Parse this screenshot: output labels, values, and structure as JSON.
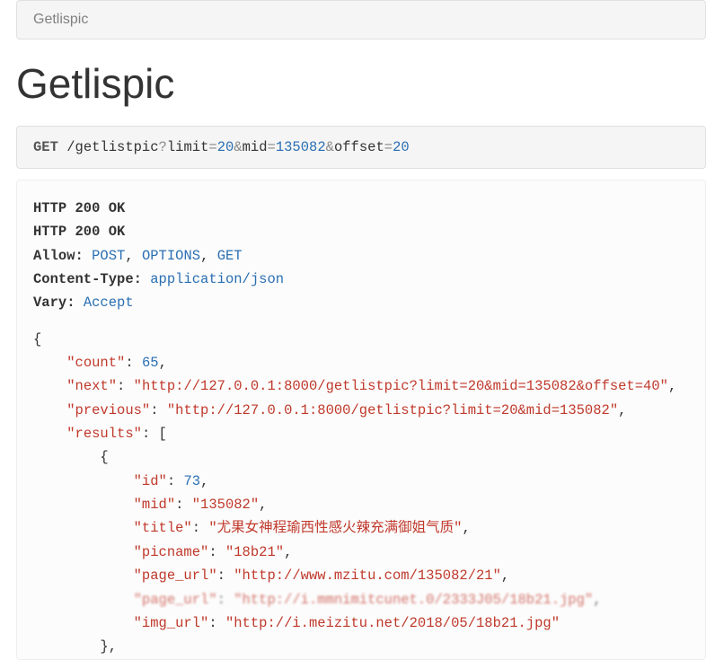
{
  "breadcrumb": "Getlispic",
  "page_title": "Getlispic",
  "request": {
    "method": "GET",
    "path": "/getlistpic",
    "params": [
      {
        "name": "limit",
        "value": "20"
      },
      {
        "name": "mid",
        "value": "135082"
      },
      {
        "name": "offset",
        "value": "20"
      }
    ]
  },
  "response": {
    "status_line_1": "HTTP 200 OK",
    "status_line_2": "HTTP 200 OK",
    "headers": {
      "allow_label": "Allow:",
      "allow_values": [
        "POST",
        "OPTIONS",
        "GET"
      ],
      "content_type_label": "Content-Type:",
      "content_type_value": "application/json",
      "vary_label": "Vary:",
      "vary_value": "Accept"
    },
    "body": {
      "count_key": "\"count\"",
      "count_val": "65",
      "next_key": "\"next\"",
      "next_val": "\"http://127.0.0.1:8000/getlistpic?limit=20&mid=135082&offset=40\"",
      "previous_key": "\"previous\"",
      "previous_val": "\"http://127.0.0.1:8000/getlistpic?limit=20&mid=135082\"",
      "results_key": "\"results\"",
      "item": {
        "id_key": "\"id\"",
        "id_val": "73",
        "mid_key": "\"mid\"",
        "mid_val": "\"135082\"",
        "title_key": "\"title\"",
        "title_val": "\"尤果女神程瑜西性感火辣充满御姐气质\"",
        "picname_key": "\"picname\"",
        "picname_val": "\"18b21\"",
        "page_url_key": "\"page_url\"",
        "page_url_val": "\"http://www.mzitu.com/135082/21\"",
        "obscured_key": "\"page_url\"",
        "obscured_val": "\"http://i.mmnimitcunet.0/2333J05/18b21.jpg\"",
        "img_url_key": "\"img_url\"",
        "img_url_val": "\"http://i.meizitu.net/2018/05/18b21.jpg\""
      }
    }
  }
}
